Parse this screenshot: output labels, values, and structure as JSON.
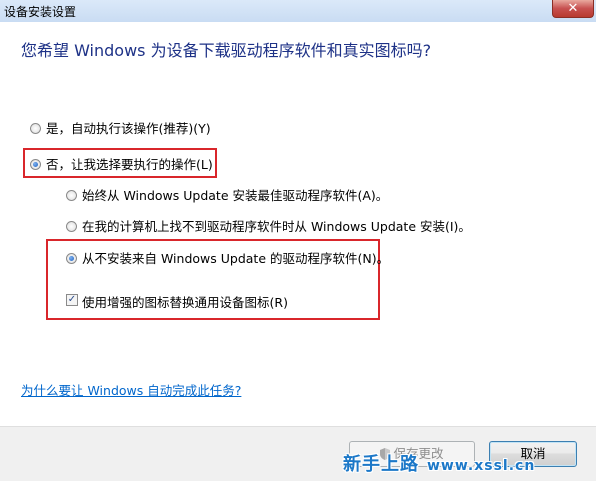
{
  "window": {
    "title": "设备安装设置",
    "close_symbol": "✕"
  },
  "question": "您希望 Windows 为设备下载驱动程序软件和真实图标吗?",
  "options": {
    "auto": "是，自动执行该操作(推荐)(Y)",
    "manual": "否，让我选择要执行的操作(L)",
    "always": "始终从 Windows Update 安装最佳驱动程序软件(A)。",
    "fallback": "在我的计算机上找不到驱动程序软件时从 Windows Update 安装(I)。",
    "never": "从不安装来自 Windows Update 的驱动程序软件(N)。",
    "enhanced_icons": "使用增强的图标替换通用设备图标(R)"
  },
  "selected": {
    "top_level": "manual",
    "sub_level": "never",
    "enhanced_icons_checked": true
  },
  "help_link": "为什么要让 Windows 自动完成此任务?",
  "buttons": {
    "save": "保存更改",
    "cancel": "取消"
  },
  "watermark": {
    "text": "新手上路",
    "url": "www.xssl.cn"
  },
  "colors": {
    "question": "#1e3287",
    "link": "#0066cc",
    "highlight_box": "#d9262b"
  }
}
